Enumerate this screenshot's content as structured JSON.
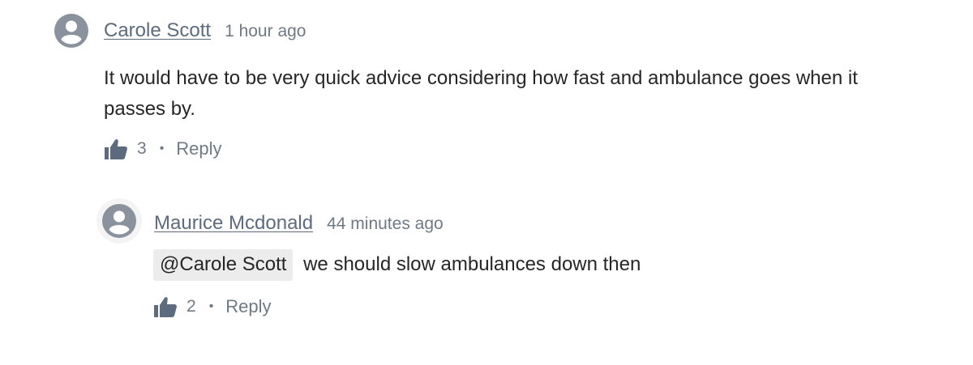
{
  "comments": [
    {
      "author": "Carole Scott",
      "time": "1 hour ago",
      "text": "It would have to be very quick advice considering how fast and ambulance goes when it passes by.",
      "likes": "3",
      "separator": "•",
      "reply_label": "Reply",
      "avatar_icon": "user-avatar-icon",
      "like_icon": "thumbs-up-icon"
    },
    {
      "author": "Maurice Mcdonald",
      "time": "44 minutes ago",
      "mention": "@Carole Scott",
      "text": "we should slow ambulances down then",
      "likes": "2",
      "separator": "•",
      "reply_label": "Reply",
      "avatar_icon": "user-avatar-icon",
      "like_icon": "thumbs-up-icon"
    }
  ],
  "colors": {
    "author_link": "#5c6b7e",
    "meta_text": "#6f7a85",
    "body_text": "#262626",
    "avatar_gray": "#8a939d",
    "mention_bg": "#ececec"
  }
}
